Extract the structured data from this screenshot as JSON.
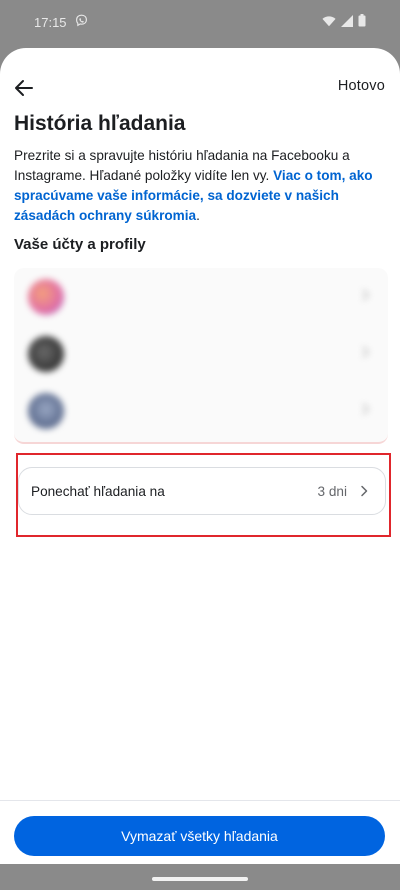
{
  "status_bar": {
    "time": "17:15",
    "icons": [
      "viber-icon",
      "wifi-icon",
      "signal-icon",
      "battery-icon"
    ]
  },
  "header": {
    "back_icon": "arrow-left-icon",
    "done_label": "Hotovo"
  },
  "page": {
    "title": "História hľadania",
    "description_text": "Prezrite si a spravujte históriu hľadania na Facebooku a Instagrame. Hľadané položky vidíte len vy. ",
    "description_link": "Viac o tom, ako spracúvame vaše informácie, sa dozviete v našich zásadách ochrany súkromia",
    "description_end": "."
  },
  "accounts": {
    "section_title": "Vaše účty a profily",
    "items": [
      {
        "name": "",
        "sub": ""
      },
      {
        "name": "",
        "sub": ""
      },
      {
        "name": "",
        "sub": ""
      }
    ]
  },
  "retention": {
    "label": "Ponechať hľadania na",
    "value": "3 dni"
  },
  "footer": {
    "clear_button": "Vymazať všetky hľadania"
  },
  "colors": {
    "accent": "#0064e0",
    "link": "#0064d1",
    "highlight_border": "#e0262c"
  }
}
